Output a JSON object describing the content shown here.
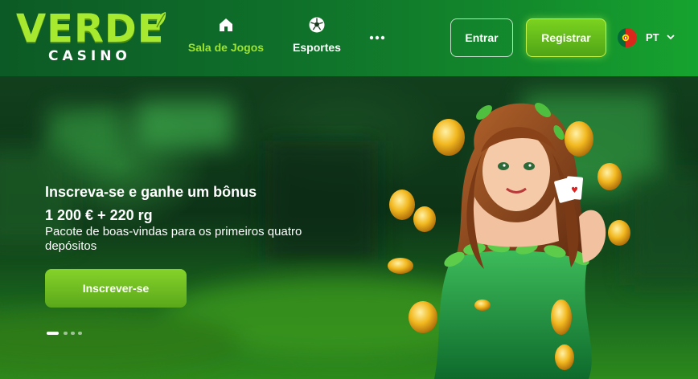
{
  "header": {
    "logo": {
      "brand": "VERDE",
      "subbrand": "CASINO"
    },
    "nav": [
      {
        "label": "Sala de Jogos",
        "icon": "home-icon",
        "active": true
      },
      {
        "label": "Esportes",
        "icon": "soccer-ball-icon",
        "active": false
      },
      {
        "label": "",
        "icon": "more-dots-icon",
        "active": false
      }
    ],
    "login_label": "Entrar",
    "register_label": "Registrar",
    "language": {
      "code": "PT",
      "flag_icon": "portugal-flag-icon"
    }
  },
  "hero": {
    "title": "Inscreva-se e ganhe um bônus",
    "amount": "1 200 € + 220 rg",
    "description": "Pacote de boas-vindas para os primeiros quatro depósitos",
    "cta_label": "Inscrever-se",
    "slides_total": 4,
    "active_slide": 1
  },
  "colors": {
    "accent": "#9ee42f",
    "register_button": "#6cc21b",
    "header_bg": "#0f6f2a"
  }
}
